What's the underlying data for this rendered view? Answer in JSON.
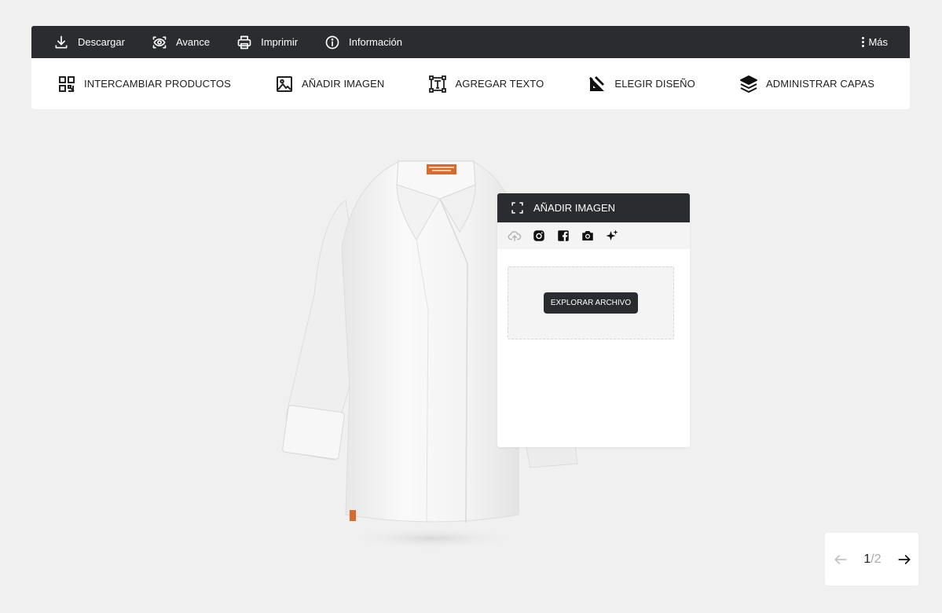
{
  "topbar": {
    "download_label": "Descargar",
    "preview_label": "Avance",
    "print_label": "Imprimir",
    "info_label": "Información",
    "more_label": "Más"
  },
  "toolbar": {
    "swap_products_label": "INTERCAMBIAR PRODUCTOS",
    "add_image_label": "AÑADIR IMAGEN",
    "add_text_label": "AGREGAR TEXTO",
    "choose_design_label": "ELEGIR DISEÑO",
    "manage_layers_label": "ADMINISTRAR CAPAS"
  },
  "panel": {
    "title": "AÑADIR IMAGEN",
    "tabs": [
      "upload-cloud-icon",
      "instagram-icon",
      "facebook-icon",
      "camera-icon",
      "ai-sparkle-icon"
    ],
    "explore_label": "EXPLORAR ARCHIVO"
  },
  "product": {
    "name": "chef-jacket-white",
    "label_text": "B.Fuel"
  },
  "pager": {
    "current": "1",
    "separator": "/",
    "total": "2"
  },
  "colors": {
    "dark_bar": "#2b2c30",
    "background": "#f0f0f0",
    "label_orange": "#d86a30"
  }
}
